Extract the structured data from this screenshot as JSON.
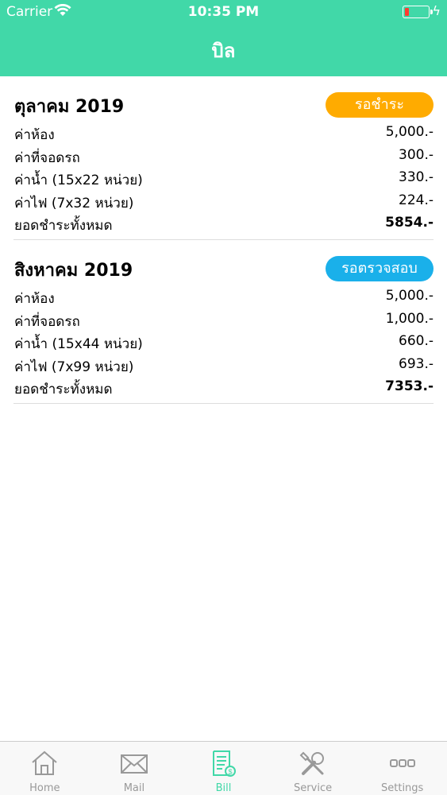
{
  "status_bar": {
    "carrier": "Carrier",
    "time": "10:35 PM"
  },
  "header": {
    "title": "บิล"
  },
  "bills": [
    {
      "month": "ตุลาคม 2019",
      "status": "รอชำระ",
      "status_color": "#ffab00",
      "items": [
        {
          "label": "ค่าห้อง",
          "amount": "5,000.-"
        },
        {
          "label": "ค่าที่จอดรถ",
          "amount": "300.-"
        },
        {
          "label": "ค่าน้ำ (15x22 หน่วย)",
          "amount": "330.-"
        },
        {
          "label": "ค่าไฟ (7x32 หน่วย)",
          "amount": "224.-"
        }
      ],
      "total_label": "ยอดชำระทั้งหมด",
      "total_amount": "5854.-"
    },
    {
      "month": "สิงหาคม 2019",
      "status": "รอตรวจสอบ",
      "status_color": "#1ab0ea",
      "items": [
        {
          "label": "ค่าห้อง",
          "amount": "5,000.-"
        },
        {
          "label": "ค่าที่จอดรถ",
          "amount": "1,000.-"
        },
        {
          "label": "ค่าน้ำ (15x44 หน่วย)",
          "amount": "660.-"
        },
        {
          "label": "ค่าไฟ (7x99 หน่วย)",
          "amount": "693.-"
        }
      ],
      "total_label": "ยอดชำระทั้งหมด",
      "total_amount": "7353.-"
    }
  ],
  "tabbar": {
    "active": "Bill",
    "active_color": "#41d8a8",
    "tabs": [
      {
        "label": "Home",
        "icon": "home-icon"
      },
      {
        "label": "Mail",
        "icon": "mail-icon"
      },
      {
        "label": "Bill",
        "icon": "bill-icon"
      },
      {
        "label": "Service",
        "icon": "tools-icon"
      },
      {
        "label": "Settings",
        "icon": "more-icon"
      }
    ]
  }
}
